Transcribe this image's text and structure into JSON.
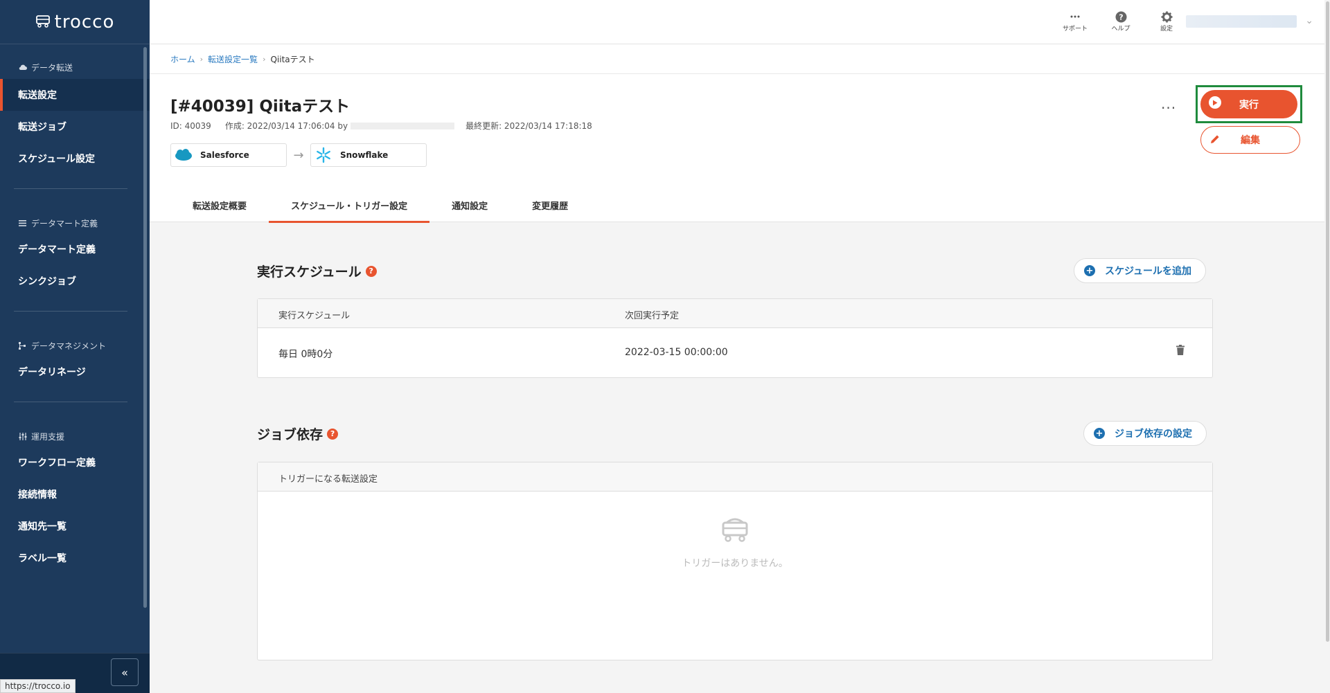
{
  "sidebar": {
    "logo": "trocco",
    "sections": [
      {
        "title": "データ転送",
        "icon": "cloud-icon",
        "items": [
          "転送設定",
          "転送ジョブ",
          "スケジュール設定"
        ]
      },
      {
        "title": "データマート定義",
        "icon": "list-icon",
        "items": [
          "データマート定義",
          "シンクジョブ"
        ]
      },
      {
        "title": "データマネジメント",
        "icon": "lineage-icon",
        "items": [
          "データリネージ"
        ]
      },
      {
        "title": "運用支援",
        "icon": "sliders-icon",
        "items": [
          "ワークフロー定義",
          "接続情報",
          "通知先一覧",
          "ラベル一覧"
        ]
      }
    ],
    "active_item": "転送設定",
    "collapse_label": "«",
    "status_url": "https://trocco.io"
  },
  "topbar": {
    "support": "サポート",
    "help": "ヘルプ",
    "settings": "設定"
  },
  "breadcrumb": {
    "home": "ホーム",
    "list": "転送設定一覧",
    "current": "Qiitaテスト"
  },
  "job": {
    "title": "[#40039] Qiitaテスト",
    "id_text": "ID: 40039",
    "created_text": "作成: 2022/03/14 17:06:04 by",
    "updated_text": "最終更新: 2022/03/14 17:18:18",
    "source": "Salesforce",
    "destination": "Snowflake",
    "run_label": "実行",
    "edit_label": "編集",
    "more_label": "···"
  },
  "tabs": [
    "転送設定概要",
    "スケジュール・トリガー設定",
    "通知設定",
    "変更履歴"
  ],
  "active_tab": "スケジュール・トリガー設定",
  "schedule": {
    "title": "実行スケジュール",
    "add_label": "スケジュールを追加",
    "headers": [
      "実行スケジュール",
      "次回実行予定"
    ],
    "rows": [
      {
        "schedule": "毎日 0時0分",
        "next": "2022-03-15 00:00:00"
      }
    ]
  },
  "dependency": {
    "title": "ジョブ依存",
    "setting_label": "ジョブ依存の設定",
    "header": "トリガーになる転送設定",
    "empty_text": "トリガーはありません。"
  },
  "colors": {
    "sidebar": "#1d3a5c",
    "accent": "#e8542f",
    "link": "#2a7ac0",
    "highlight": "#1f8b3d"
  }
}
